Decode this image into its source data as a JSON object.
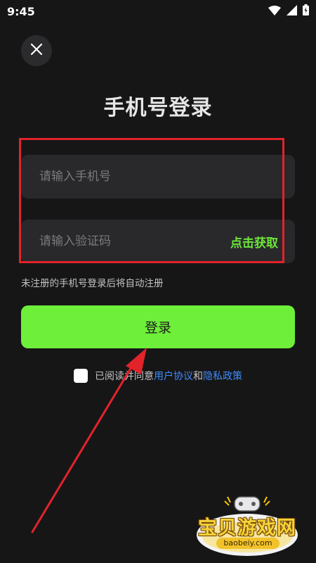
{
  "status_bar": {
    "time": "9:45",
    "icons": [
      "wifi-icon",
      "signal-icon",
      "battery-icon"
    ]
  },
  "header": {
    "close_icon": "close-icon",
    "title": "手机号登录"
  },
  "form": {
    "phone_placeholder": "请输入手机号",
    "code_placeholder": "请输入验证码",
    "get_code_label": "点击获取",
    "hint": "未注册的手机号登录后将自动注册",
    "login_label": "登录"
  },
  "agreement": {
    "prefix": "已阅读并同意",
    "user_agreement": "用户协议",
    "and": "和",
    "privacy_policy": "隐私政策"
  },
  "watermark": {
    "title": "宝贝游戏网",
    "url": "baobeiy.com"
  },
  "colors": {
    "background": "#161617",
    "input_bg": "#29292c",
    "accent_green": "#6ef03a",
    "link_blue": "#3d8cff",
    "annotation_red": "#e2232a"
  }
}
